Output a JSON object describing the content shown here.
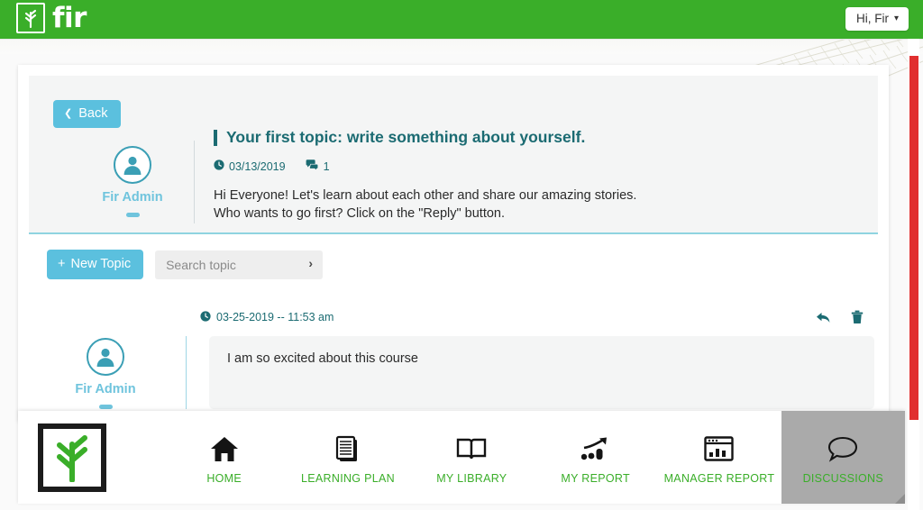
{
  "header": {
    "brand_name": "fir",
    "brand_icon": "fir-sprout-logo-icon",
    "user_greeting": "Hi, Fir",
    "caret_icon": "chevron-down-icon"
  },
  "topic": {
    "back_label": "Back",
    "back_icon": "chevron-left-icon",
    "author": "Fir Admin",
    "avatar_icon": "user-avatar-icon",
    "title": "Your first topic: write something about yourself.",
    "date": "03/13/2019",
    "date_icon": "clock-icon",
    "comment_count": "1",
    "comment_icon": "comments-icon",
    "body_line1": "Hi Everyone! Let's learn about each other and share our amazing stories.",
    "body_line2": "Who wants to go first? Click on the \"Reply\" button."
  },
  "actions": {
    "new_topic_label": "New Topic",
    "new_topic_icon": "plus-icon",
    "search_placeholder": "Search topic",
    "search_value": "",
    "search_submit_icon": "chevron-right-icon"
  },
  "reply": {
    "timestamp": "03-25-2019 -- 11:53 am",
    "timestamp_icon": "clock-icon",
    "reply_icon": "reply-arrow-icon",
    "delete_icon": "trash-icon",
    "author": "Fir Admin",
    "avatar_icon": "user-avatar-icon",
    "message": "I am so excited about this course"
  },
  "bottom_nav": {
    "logo_icon": "fir-sprout-logo-icon",
    "items": [
      {
        "label": "HOME",
        "icon": "home-icon",
        "active": false
      },
      {
        "label": "LEARNING PLAN",
        "icon": "documents-icon",
        "active": false
      },
      {
        "label": "MY LIBRARY",
        "icon": "open-book-icon",
        "active": false
      },
      {
        "label": "MY REPORT",
        "icon": "growth-chart-icon",
        "active": false
      },
      {
        "label": "MANAGER REPORT",
        "icon": "dashboard-chart-icon",
        "active": false
      },
      {
        "label": "DISCUSSIONS",
        "icon": "speech-bubble-icon",
        "active": true
      }
    ]
  },
  "colors": {
    "brand_green": "#3aae29",
    "accent_blue": "#5bc0de",
    "teal_text": "#1b6b72",
    "light_blue_text": "#6fc4dd",
    "scrollbar_red": "#e12f2f",
    "active_nav_gray": "#aaaaaa"
  }
}
